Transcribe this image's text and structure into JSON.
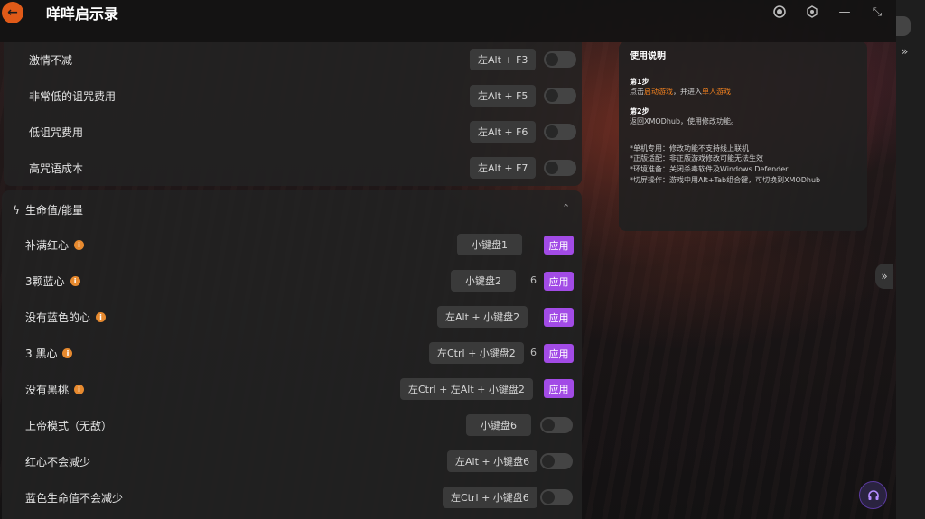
{
  "app": {
    "title": "咩咩启示录"
  },
  "top_group": {
    "rows": [
      {
        "label": "激情不减",
        "hotkey": "左Alt + F3"
      },
      {
        "label": "非常低的诅咒费用",
        "hotkey": "左Alt + F5"
      },
      {
        "label": "低诅咒费用",
        "hotkey": "左Alt + F6"
      },
      {
        "label": "高咒语成本",
        "hotkey": "左Alt + F7"
      }
    ]
  },
  "hp_group": {
    "title": "生命值/能量",
    "rows": [
      {
        "label": "补满红心",
        "hotkey": "小键盘1",
        "apply": "应用",
        "info": "i"
      },
      {
        "label": "3颗蓝心",
        "hotkey": "小键盘2",
        "count": "6",
        "apply": "应用",
        "info": "i"
      },
      {
        "label": "没有蓝色的心",
        "hotkey": "左Alt + 小键盘2",
        "apply": "应用",
        "info": "i"
      },
      {
        "label": "3 黑心",
        "hotkey": "左Ctrl + 小键盘2",
        "count": "6",
        "apply": "应用",
        "info": "i"
      },
      {
        "label": "没有黑桃",
        "hotkey": "左Ctrl + 左Alt + 小键盘2",
        "apply": "应用",
        "info": "i"
      },
      {
        "label": "上帝模式（无敌）",
        "hotkey": "小键盘6"
      },
      {
        "label": "红心不会减少",
        "hotkey": "左Alt + 小键盘6"
      },
      {
        "label": "蓝色生命值不会减少",
        "hotkey": "左Ctrl + 小键盘6"
      }
    ]
  },
  "guide": {
    "title": "使用说明",
    "step1_title": "第1步",
    "step1_prefix": "点击",
    "step1_link1": "启动游戏",
    "step1_mid": "，并进入",
    "step1_link2": "单人游戏",
    "step2_title": "第2步",
    "step2_text": "返回XMODhub，使用修改功能。",
    "notes": [
      "*单机专用：修改功能不支持线上联机",
      "*正版适配：非正版游戏修改可能无法生效",
      "*环境准备：关闭杀毒软件及Windows Defender",
      "*切屏操作：游戏中用Alt+Tab组合键，可切换到XMODhub"
    ]
  },
  "colors": {
    "accent_orange": "#e05a18",
    "apply_purple": "#a24be6"
  }
}
